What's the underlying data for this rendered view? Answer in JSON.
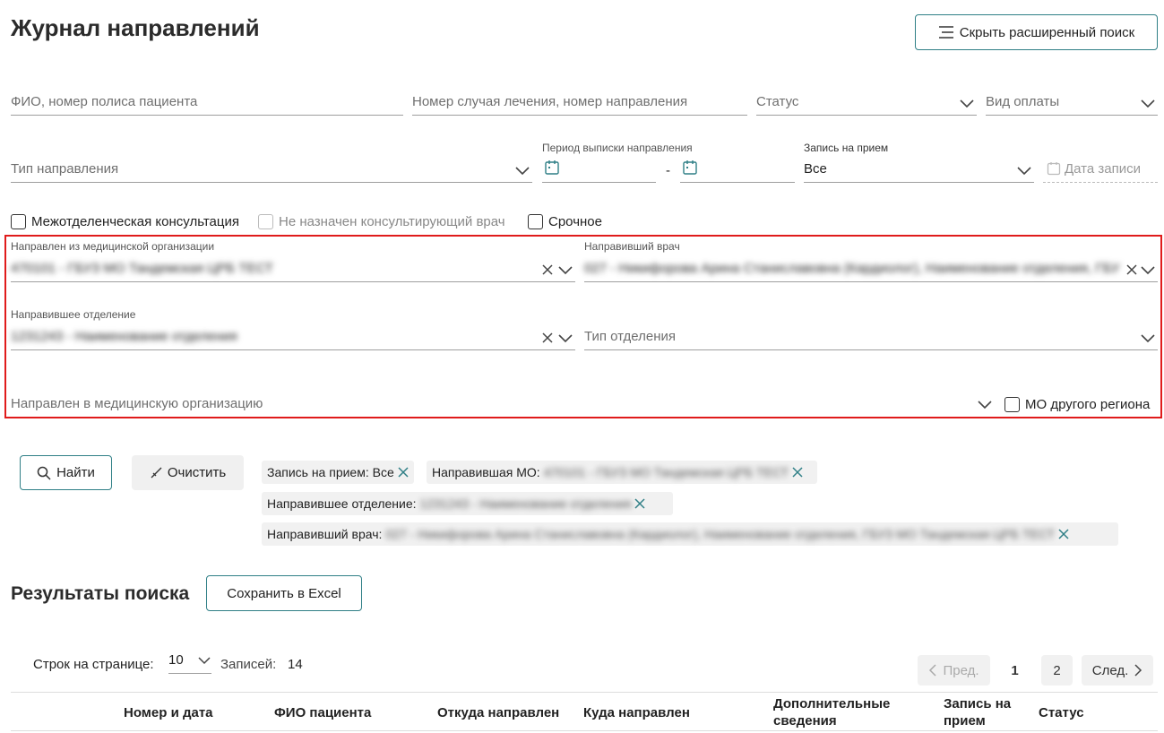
{
  "page": {
    "title": "Журнал направлений",
    "toggle_search_label": "Скрыть расширенный поиск"
  },
  "filters": {
    "patient_placeholder": "ФИО, номер полиса пациента",
    "case_placeholder": "Номер случая лечения, номер направления",
    "status_placeholder": "Статус",
    "payment_placeholder": "Вид оплаты",
    "direction_type_placeholder": "Тип направления",
    "period_label": "Период выписки направления",
    "period_separator": "-",
    "appointment_label": "Запись на прием",
    "appointment_value": "Все",
    "appointment_date_placeholder": "Дата записи",
    "interdept_label": "Межотделенческая консультация",
    "no_doctor_label": "Не назначен консультирующий врач",
    "urgent_label": "Срочное",
    "from_org_label": "Направлен из медицинской организации",
    "from_org_value": "470101 - ГБУЗ МО Тандемская ЦРБ ТЕСТ",
    "doctor_label": "Направивший врач",
    "doctor_value": "027 - Никифорова Арина Станиславовна (Кардиолог), Наименование отделения, ГБУ",
    "from_dept_label": "Направившее отделение",
    "from_dept_value": "1231243 - Наименование отделения",
    "dept_type_placeholder": "Тип отделения",
    "to_org_placeholder": "Направлен в медицинскую организацию",
    "other_region_label": "МО другого региона"
  },
  "actions": {
    "find_label": "Найти",
    "clear_label": "Очистить"
  },
  "chips": [
    {
      "label": "Запись на прием: Все",
      "value": ""
    },
    {
      "label": "Направившая МО:",
      "value": "470101 - ГБУЗ МО Тандемская ЦРБ ТЕСТ"
    },
    {
      "label": "Направившее отделение:",
      "value": "1231243 - Наименование отделения"
    },
    {
      "label": "Направивший врач:",
      "value": "027 - Никифорова Арина Станиславовна (Кардиолог), Наименование отделения, ГБУЗ МО Тандемская ЦРБ ТЕСТ"
    }
  ],
  "results": {
    "title": "Результаты поиска",
    "export_label": "Сохранить в Excel",
    "rows_per_page_label": "Строк на странице:",
    "rows_per_page_value": "10",
    "records_label": "Записей:",
    "records_value": "14",
    "prev_label": "Пред.",
    "next_label": "След.",
    "pages": [
      "1",
      "2"
    ],
    "columns": [
      "Номер и дата",
      "ФИО пациента",
      "Откуда направлен",
      "Куда направлен",
      "Дополнительные сведения",
      "Запись на прием",
      "Статус"
    ]
  },
  "colors": {
    "accent": "#2f7f86",
    "highlight": "#e01b1b"
  },
  "icons": [
    "menu-icon",
    "chevron-down-icon",
    "calendar-icon",
    "close-icon",
    "search-icon",
    "broom-icon",
    "chevron-left-icon",
    "chevron-right-icon"
  ]
}
